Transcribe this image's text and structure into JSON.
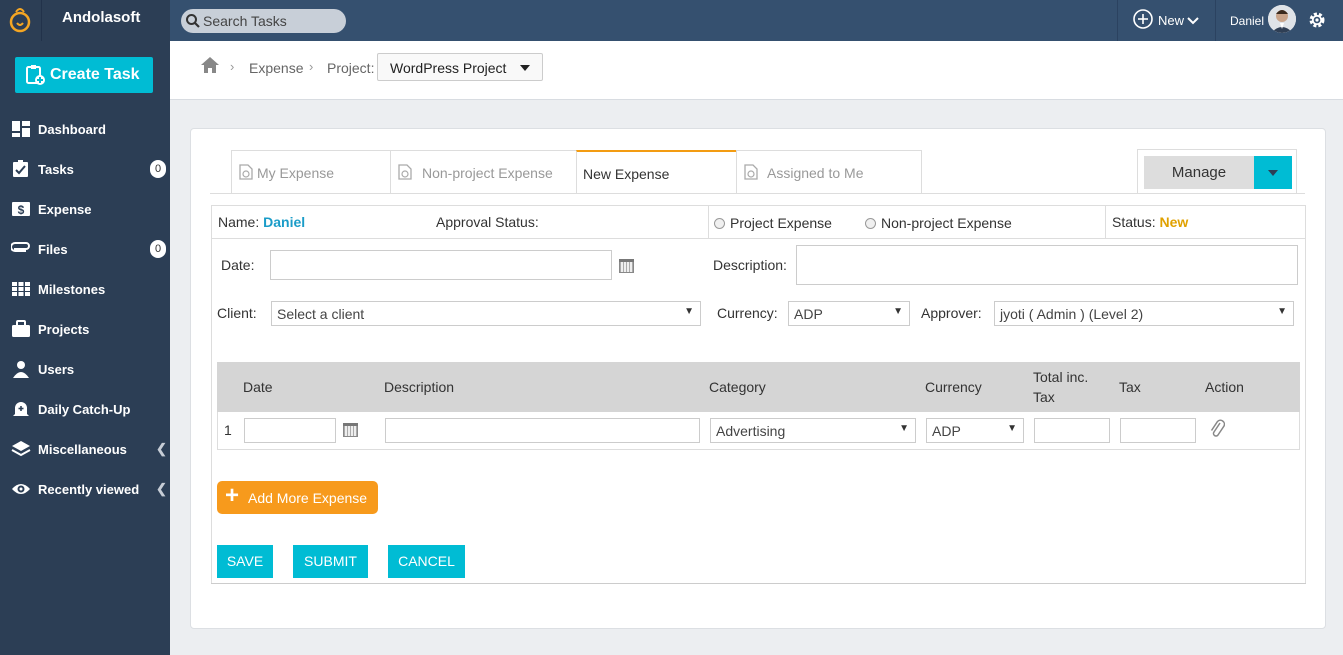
{
  "app": {
    "name": "Andolasoft"
  },
  "search": {
    "placeholder": "Search Tasks"
  },
  "topbar": {
    "new_label": "New",
    "user_name": "Daniel"
  },
  "sidebar": {
    "create_task": "Create Task",
    "items": [
      {
        "label": "Dashboard",
        "icon": "dashboard-icon"
      },
      {
        "label": "Tasks",
        "icon": "tasks-icon",
        "badge": "0"
      },
      {
        "label": "Expense",
        "icon": "expense-icon"
      },
      {
        "label": "Files",
        "icon": "files-icon",
        "badge": "0"
      },
      {
        "label": "Milestones",
        "icon": "milestones-icon"
      },
      {
        "label": "Projects",
        "icon": "projects-icon"
      },
      {
        "label": "Users",
        "icon": "users-icon"
      },
      {
        "label": "Daily Catch-Up",
        "icon": "bell-icon"
      },
      {
        "label": "Miscellaneous",
        "icon": "layers-icon"
      },
      {
        "label": "Recently viewed",
        "icon": "eye-icon"
      }
    ]
  },
  "breadcrumb": {
    "expense": "Expense",
    "project_label": "Project:",
    "project_value": "WordPress Project"
  },
  "tabs": [
    {
      "label": "My Expense"
    },
    {
      "label": "Non-project Expense"
    },
    {
      "label": "New Expense"
    },
    {
      "label": "Assigned to Me"
    }
  ],
  "manage": {
    "label": "Manage"
  },
  "info": {
    "name_label": "Name:",
    "name_value": "Daniel",
    "approval_label": "Approval Status:",
    "project_expense": "Project Expense",
    "non_project_expense": "Non-project Expense",
    "status_label": "Status:",
    "status_value": "New"
  },
  "form": {
    "date_label": "Date:",
    "description_label": "Description:",
    "client_label": "Client:",
    "client_value": "Select a client",
    "currency_label": "Currency:",
    "currency_value": "ADP",
    "approver_label": "Approver:",
    "approver_value": "jyoti ( Admin ) (Level 2)"
  },
  "grid": {
    "headers": {
      "date": "Date",
      "description": "Description",
      "category": "Category",
      "currency": "Currency",
      "total_line1": "Total inc.",
      "total_line2": "Tax",
      "tax": "Tax",
      "action": "Action"
    },
    "row": {
      "index": "1",
      "category": "Advertising",
      "currency": "ADP"
    }
  },
  "buttons": {
    "add_more": "Add More Expense",
    "save": "SAVE",
    "submit": "SUBMIT",
    "cancel": "CANCEL"
  },
  "colors": {
    "accent": "#00bcd4",
    "sidebar": "#2c3e55",
    "topbar": "#35506f",
    "orange": "#f79a1c"
  }
}
